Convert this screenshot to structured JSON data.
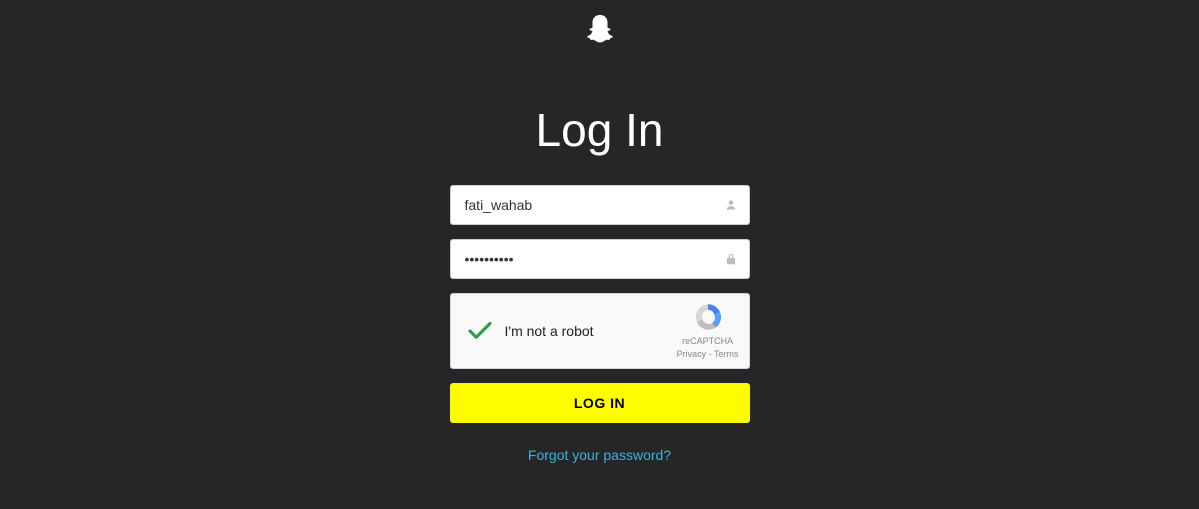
{
  "title": "Log In",
  "form": {
    "username_value": "fati_wahab",
    "password_value": "••••••••••",
    "login_button_label": "LOG IN",
    "forgot_link_label": "Forgot your password?"
  },
  "recaptcha": {
    "label": "I'm not a robot",
    "brand": "reCAPTCHA",
    "privacy": "Privacy",
    "sep": " - ",
    "terms": "Terms"
  }
}
